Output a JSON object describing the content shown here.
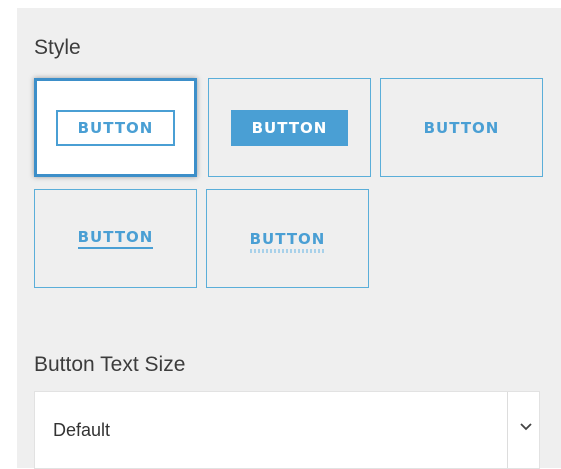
{
  "style_section": {
    "heading": "Style",
    "options": [
      {
        "label": "BUTTON",
        "variant": "outline",
        "selected": true
      },
      {
        "label": "BUTTON",
        "variant": "filled",
        "selected": false
      },
      {
        "label": "BUTTON",
        "variant": "text",
        "selected": false
      },
      {
        "label": "BUTTON",
        "variant": "underline",
        "selected": false
      },
      {
        "label": "BUTTON",
        "variant": "dotted-underline",
        "selected": false
      }
    ]
  },
  "text_size_section": {
    "heading": "Button Text Size",
    "select_value": "Default",
    "select_icon": "chevron-down-icon"
  },
  "colors": {
    "accent": "#4a9fd4",
    "panel_background": "#efefef"
  }
}
